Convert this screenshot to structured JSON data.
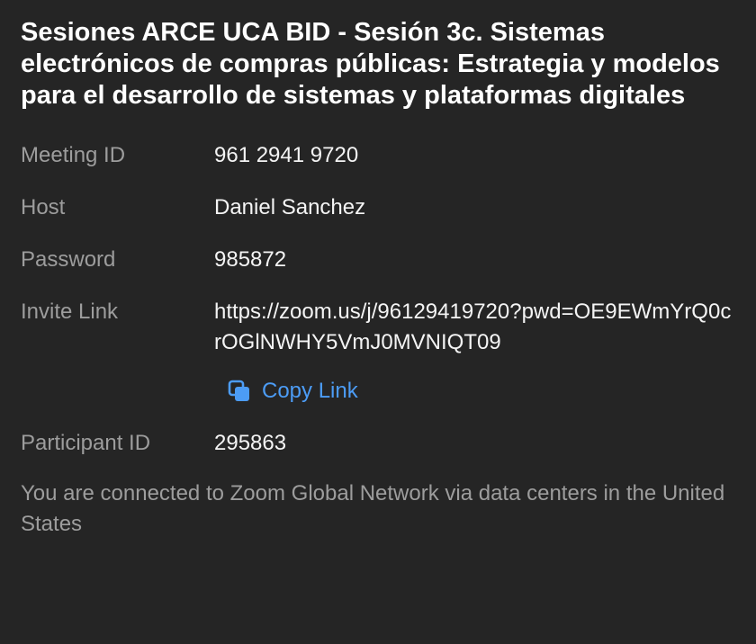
{
  "meeting": {
    "title": "Sesiones ARCE UCA BID - Sesión 3c. Sistemas electrónicos de compras públicas: Estrategia y modelos para el desarrollo de sistemas y plataformas digitales"
  },
  "details": {
    "meeting_id_label": "Meeting ID",
    "meeting_id_value": "961 2941 9720",
    "host_label": "Host",
    "host_value": "Daniel Sanchez",
    "password_label": "Password",
    "password_value": "985872",
    "invite_label": "Invite Link",
    "invite_value": "https://zoom.us/j/96129419720?pwd=OE9EWmYrQ0crOGlNWHY5VmJ0MVNIQT09",
    "copy_link_label": "Copy Link",
    "participant_label": "Participant ID",
    "participant_value": "295863"
  },
  "footer": {
    "network_text": "You are connected to Zoom Global Network via data centers in the United States"
  },
  "colors": {
    "background": "#252525",
    "accent": "#4c9cf5",
    "label": "#9d9d9d",
    "value": "#f4f4f4"
  },
  "icons": {
    "copy": "copy-icon"
  }
}
